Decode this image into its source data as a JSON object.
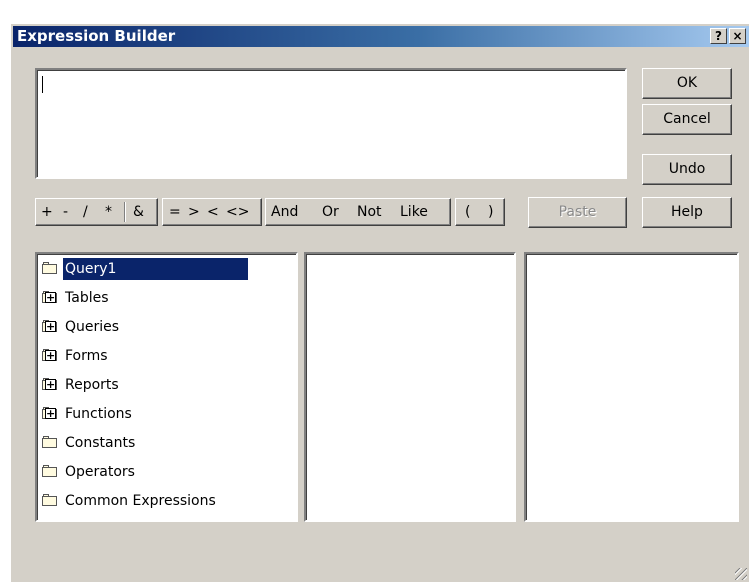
{
  "window": {
    "title": "Expression Builder",
    "help_caption": "?",
    "close_caption": "×"
  },
  "buttons": {
    "ok": "OK",
    "cancel": "Cancel",
    "undo": "Undo",
    "help": "Help",
    "paste": "Paste"
  },
  "expression": {
    "value": ""
  },
  "operators": {
    "plus": "+",
    "minus": "-",
    "divide": "/",
    "multiply": "*",
    "concat": "&",
    "equals": "=",
    "greater": ">",
    "less": "<",
    "not_equal": "<>",
    "and": "And",
    "or": "Or",
    "not": "Not",
    "like": "Like",
    "open_paren": "(",
    "close_paren": ")"
  },
  "tree": {
    "items": [
      {
        "label": "Query1",
        "icon": "folder-open-icon",
        "selected": true
      },
      {
        "label": "Tables",
        "icon": "expand-plus-icon"
      },
      {
        "label": "Queries",
        "icon": "expand-plus-icon"
      },
      {
        "label": "Forms",
        "icon": "expand-plus-icon"
      },
      {
        "label": "Reports",
        "icon": "expand-plus-icon"
      },
      {
        "label": "Functions",
        "icon": "expand-plus-icon"
      },
      {
        "label": "Constants",
        "icon": "folder-icon"
      },
      {
        "label": "Operators",
        "icon": "folder-icon"
      },
      {
        "label": "Common Expressions",
        "icon": "folder-icon"
      }
    ]
  },
  "colors": {
    "titlebar_start": "#0a246a",
    "titlebar_end": "#a6caf0",
    "dialog_face": "#d4d0c8",
    "selection": "#0a246a"
  }
}
